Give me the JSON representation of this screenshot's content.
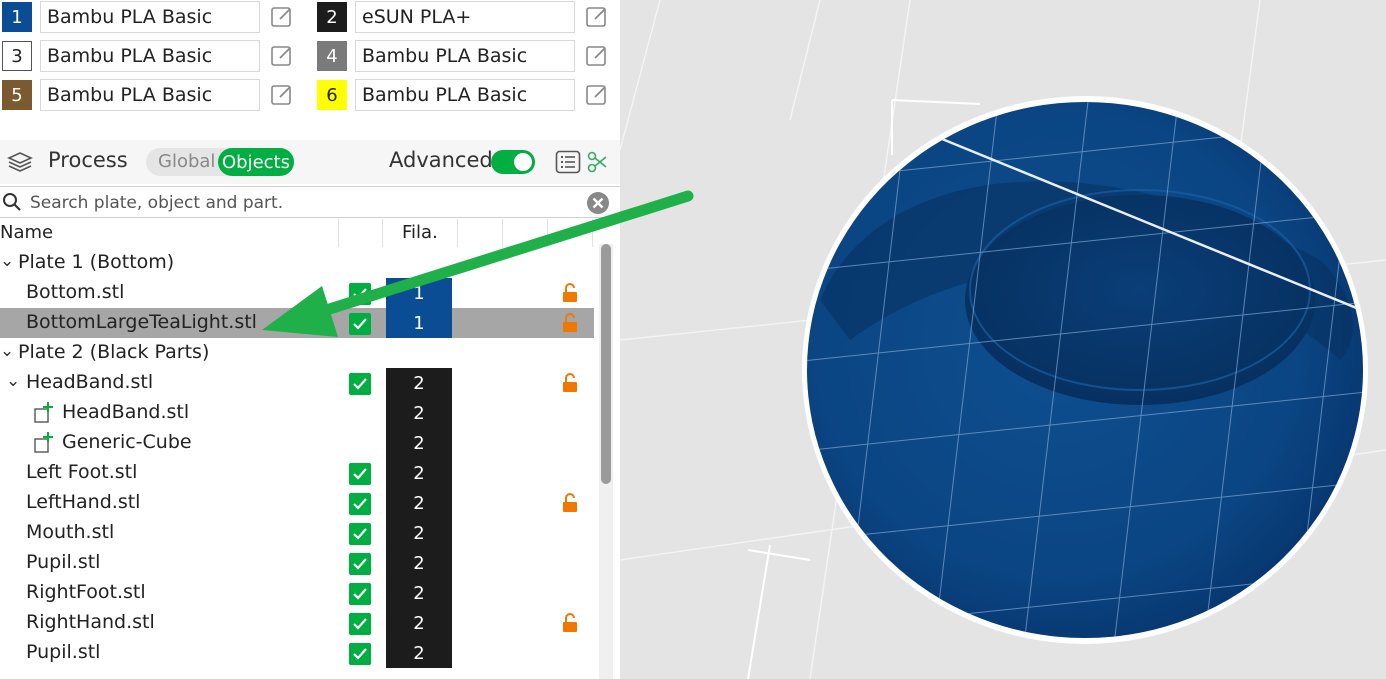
{
  "filaments": [
    {
      "index": "1",
      "name": "Bambu PLA Basic",
      "color": "#0a4d94",
      "text_color": "#ffffff"
    },
    {
      "index": "2",
      "name": "eSUN PLA+",
      "color": "#1c1c1c",
      "text_color": "#ffffff"
    },
    {
      "index": "3",
      "name": "Bambu PLA Basic",
      "color": "#ffffff",
      "text_color": "#222222"
    },
    {
      "index": "4",
      "name": "Bambu PLA Basic",
      "color": "#7a7a7a",
      "text_color": "#ffffff"
    },
    {
      "index": "5",
      "name": "Bambu PLA Basic",
      "color": "#7a5a2e",
      "text_color": "#ffffff"
    },
    {
      "index": "6",
      "name": "Bambu PLA Basic",
      "color": "#ffff00",
      "text_color": "#222222"
    }
  ],
  "process": {
    "title": "Process",
    "toggle_global": "Global",
    "toggle_objects": "Objects",
    "advanced_label": "Advanced"
  },
  "search": {
    "placeholder": "Search plate, object and part."
  },
  "table": {
    "col_name": "Name",
    "col_fila": "Fila.",
    "rows": [
      {
        "type": "plate",
        "label": "Plate 1 (Bottom)"
      },
      {
        "type": "object",
        "label": "Bottom.stl",
        "checked": true,
        "fila": "1",
        "locked": true
      },
      {
        "type": "object",
        "label": "BottomLargeTeaLight.stl",
        "checked": true,
        "fila": "1",
        "locked": true,
        "selected": true
      },
      {
        "type": "plate",
        "label": "Plate 2 (Black Parts)"
      },
      {
        "type": "object",
        "label": "HeadBand.stl",
        "checked": true,
        "fila": "2",
        "locked": true,
        "expanded": true
      },
      {
        "type": "part",
        "label": "HeadBand.stl",
        "fila": "2"
      },
      {
        "type": "part",
        "label": "Generic-Cube",
        "fila": "2"
      },
      {
        "type": "object",
        "label": "Left Foot.stl",
        "checked": true,
        "fila": "2"
      },
      {
        "type": "object",
        "label": "LeftHand.stl",
        "checked": true,
        "fila": "2",
        "locked": true
      },
      {
        "type": "object",
        "label": "Mouth.stl",
        "checked": true,
        "fila": "2"
      },
      {
        "type": "object",
        "label": "Pupil.stl",
        "checked": true,
        "fila": "2"
      },
      {
        "type": "object",
        "label": "RightFoot.stl",
        "checked": true,
        "fila": "2"
      },
      {
        "type": "object",
        "label": "RightHand.stl",
        "checked": true,
        "fila": "2",
        "locked": true
      },
      {
        "type": "object",
        "label": "Pupil.stl",
        "checked": true,
        "fila": "2"
      }
    ]
  },
  "icons": {
    "edit": "edit-pencil-icon",
    "process": "layers-icon",
    "search": "search-icon",
    "clear": "clear-icon",
    "lock": "unlocked-padlock-icon",
    "check": "checkmark-icon",
    "list": "list-icon",
    "settings": "scissors-settings-icon"
  },
  "colors": {
    "accent": "#00ae42",
    "lock": "#f07800",
    "model": "#0b4a8c",
    "annotation_arrow": "#1fb04a"
  }
}
